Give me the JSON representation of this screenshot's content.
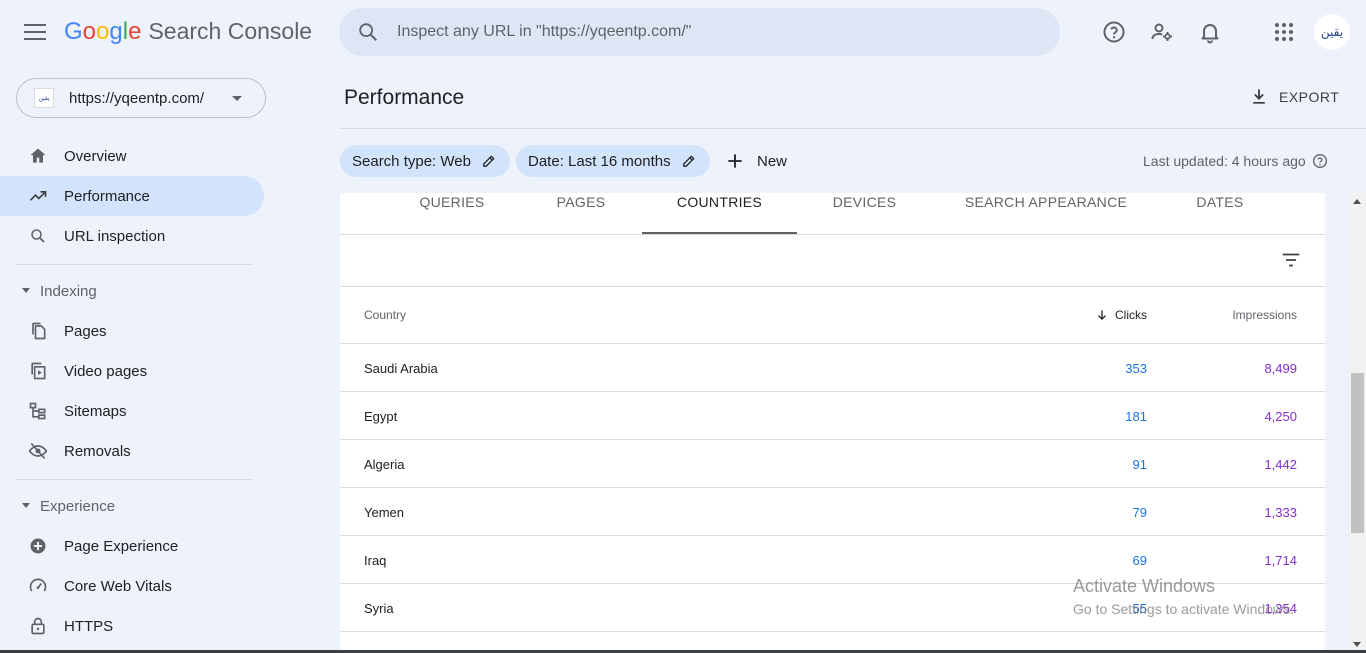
{
  "app": {
    "logo_letters": [
      "G",
      "o",
      "o",
      "g",
      "l",
      "e"
    ],
    "product": "Search Console"
  },
  "search": {
    "placeholder": "Inspect any URL in \"https://yqeentp.com/\""
  },
  "avatar_text": "يقين",
  "property": {
    "favicon_text": "يقين",
    "url": "https://yqeentp.com/"
  },
  "sidebar": {
    "items": [
      {
        "label": "Overview",
        "icon": "home-icon"
      },
      {
        "label": "Performance",
        "icon": "trending-up-icon"
      },
      {
        "label": "URL inspection",
        "icon": "search-icon"
      }
    ],
    "sections": [
      {
        "title": "Indexing",
        "items": [
          {
            "label": "Pages",
            "icon": "pages-icon"
          },
          {
            "label": "Video pages",
            "icon": "video-pages-icon"
          },
          {
            "label": "Sitemaps",
            "icon": "sitemaps-icon"
          },
          {
            "label": "Removals",
            "icon": "removals-icon"
          }
        ]
      },
      {
        "title": "Experience",
        "items": [
          {
            "label": "Page Experience",
            "icon": "page-experience-icon"
          },
          {
            "label": "Core Web Vitals",
            "icon": "speed-gauge-icon"
          },
          {
            "label": "HTTPS",
            "icon": "lock-icon"
          }
        ]
      }
    ]
  },
  "main": {
    "title": "Performance",
    "export_label": "EXPORT",
    "chips": [
      {
        "label": "Search type: Web"
      },
      {
        "label": "Date: Last 16 months"
      }
    ],
    "new_label": "New",
    "last_updated": "Last updated: 4 hours ago",
    "tabs": [
      {
        "label": "QUERIES",
        "active": false
      },
      {
        "label": "PAGES",
        "active": false
      },
      {
        "label": "COUNTRIES",
        "active": true
      },
      {
        "label": "DEVICES",
        "active": false
      },
      {
        "label": "SEARCH APPEARANCE",
        "active": false
      },
      {
        "label": "DATES",
        "active": false
      }
    ],
    "table": {
      "headers": {
        "country": "Country",
        "clicks": "Clicks",
        "impressions": "Impressions"
      },
      "rows": [
        {
          "country": "Saudi Arabia",
          "clicks": "353",
          "impressions": "8,499"
        },
        {
          "country": "Egypt",
          "clicks": "181",
          "impressions": "4,250"
        },
        {
          "country": "Algeria",
          "clicks": "91",
          "impressions": "1,442"
        },
        {
          "country": "Yemen",
          "clicks": "79",
          "impressions": "1,333"
        },
        {
          "country": "Iraq",
          "clicks": "69",
          "impressions": "1,714"
        },
        {
          "country": "Syria",
          "clicks": "55",
          "impressions": "1,354"
        }
      ]
    }
  },
  "watermark": {
    "line1": "Activate Windows",
    "line2": "Go to Settings to activate Windows."
  },
  "colors": {
    "accent": "#1a73e8",
    "impressions": "#8430ce",
    "active_nav": "#d2e3fc"
  }
}
